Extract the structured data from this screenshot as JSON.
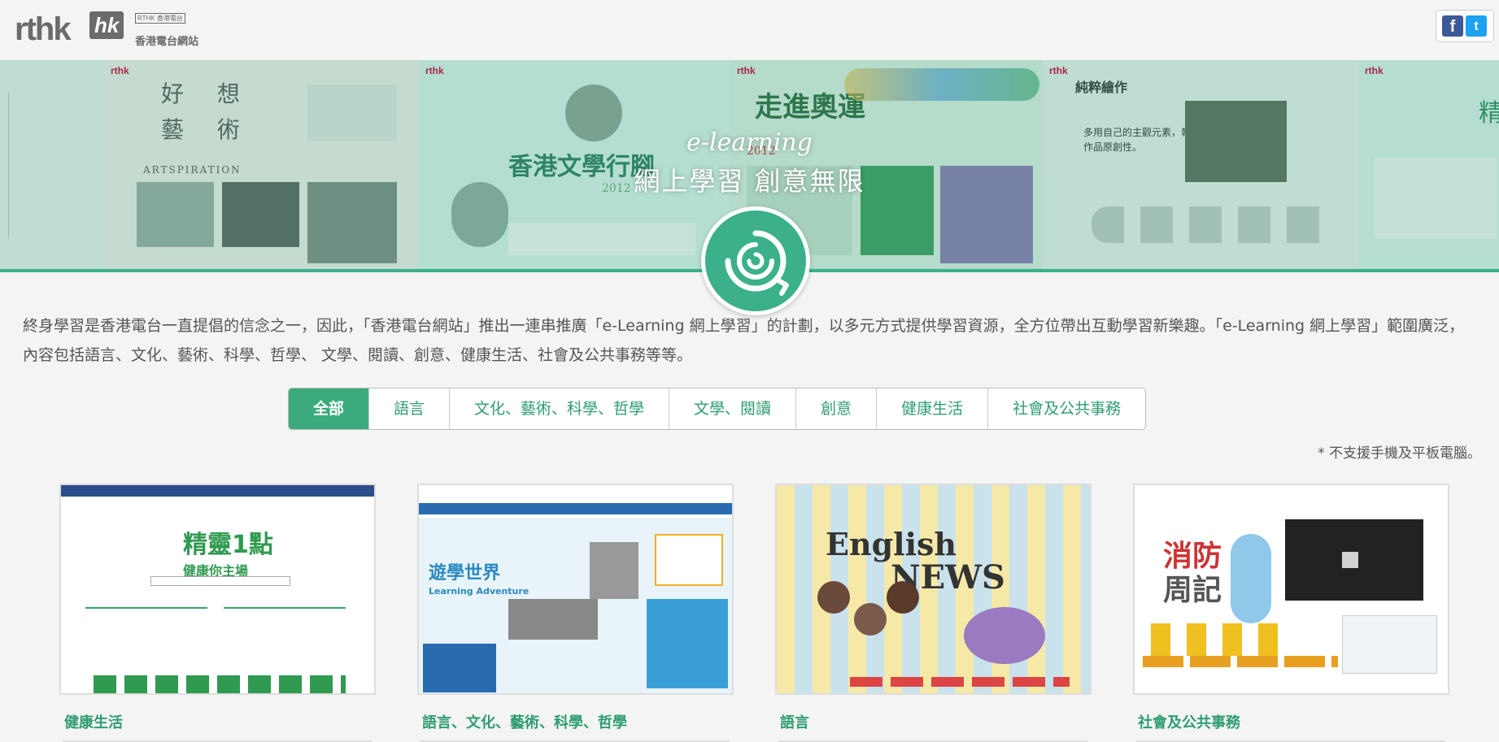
{
  "header": {
    "logo_main": "rthk",
    "logo_hk": "hk",
    "logo_badge": "RTHK 香港電台",
    "logo_sub": "香港電台網站",
    "facebook_glyph": "f",
    "twitter_glyph": "t"
  },
  "banner": {
    "title": "e-learning",
    "subtitle": "網上學習  創意無限",
    "panels": [
      {
        "logo": "",
        "headline": ""
      },
      {
        "logo": "rthk",
        "headline": "好 想 藝 術",
        "caption": "ARTSPIRATION"
      },
      {
        "logo": "rthk",
        "headline": "香港文學行腳",
        "caption": "2012"
      },
      {
        "logo": "rthk",
        "headline": "走進奧運",
        "caption": "2012"
      },
      {
        "logo": "rthk",
        "headline": "純粹繪作",
        "caption": "多用自己的主觀元素，執著作品原創性。"
      },
      {
        "logo": "rthk",
        "headline": "精",
        "caption": ""
      }
    ],
    "icon": "elearning-swirl-icon"
  },
  "intro": {
    "text": "終身學習是香港電台一直提倡的信念之一，因此，「香港電台網站」推出一連串推廣「e-Learning 網上學習」的計劃，以多元方式提供學習資源，全方位帶出互動學習新樂趣。「e-Learning 網上學習」範圍廣泛，內容包括語言、文化、藝術、科學、哲學、 文學、閱讀、創意、健康生活、社會及公共事務等等。"
  },
  "tabs": [
    {
      "label": "全部",
      "active": true
    },
    {
      "label": "語言",
      "active": false
    },
    {
      "label": "文化、藝術、科學、哲學",
      "active": false
    },
    {
      "label": "文學、閱讀",
      "active": false
    },
    {
      "label": "創意",
      "active": false
    },
    {
      "label": "健康生活",
      "active": false
    },
    {
      "label": "社會及公共事務",
      "active": false
    }
  ],
  "note": "* 不支援手機及平板電腦。",
  "cards": [
    {
      "label": "健康生活",
      "thumb_title": "精靈1點",
      "thumb_sub": "健康你主場"
    },
    {
      "label": "語言、文化、藝術、科學、哲學",
      "thumb_title": "遊學世界",
      "thumb_sub": "Learning Adventure"
    },
    {
      "label": "語言",
      "thumb_title": "English",
      "thumb_sub": "NEWS"
    },
    {
      "label": "社會及公共事務",
      "thumb_title": "消防",
      "thumb_sub": "周記"
    }
  ],
  "colors": {
    "accent": "#3bab7e",
    "accent_text": "#2e9d70",
    "facebook": "#3b5998",
    "twitter": "#1da1f2"
  }
}
